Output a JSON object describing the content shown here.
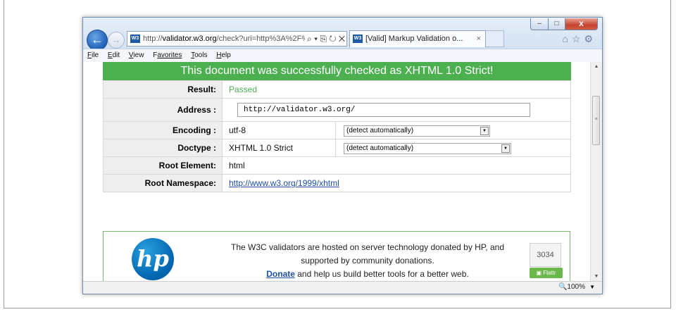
{
  "browser": {
    "address_url_prefix": "http://",
    "address_url_host": "validator.w3.org",
    "address_url_rest": "/check?uri=http%3A%2F%",
    "address_controls": "⌕ ▾ ⎘ ↻ ✕",
    "tab_title": "[Valid] Markup Validation o...",
    "tab_close": "×",
    "favicon_text": "W3",
    "back_glyph": "←",
    "forward_glyph": "→",
    "window_controls": {
      "min": "‒",
      "max": "□",
      "close": "x"
    },
    "toolbar_icons": [
      "home-icon",
      "star-icon",
      "gear-icon"
    ],
    "toolbar_glyphs": "⌂☆⚙",
    "menu": [
      {
        "underline": "F",
        "rest": "ile"
      },
      {
        "underline": "E",
        "rest": "dit"
      },
      {
        "underline": "V",
        "rest": "iew"
      },
      {
        "underline": "F",
        "rest": "avorites"
      },
      {
        "underline": "T",
        "rest": "ools"
      },
      {
        "underline": "H",
        "rest": "elp"
      }
    ],
    "zoom": "100%",
    "zoom_icon": "🔍",
    "zoom_dropdown": "▼"
  },
  "validation": {
    "banner": "This document was successfully checked as XHTML 1.0 Strict!",
    "rows": {
      "result_label": "Result:",
      "result_value": "Passed",
      "address_label": "Address :",
      "address_value": "http://validator.w3.org/",
      "encoding_label": "Encoding :",
      "encoding_value": "utf-8",
      "encoding_select": "(detect automatically)",
      "doctype_label": "Doctype :",
      "doctype_value": "XHTML 1.0 Strict",
      "doctype_select": "(detect automatically)",
      "root_element_label": "Root Element:",
      "root_element_value": "html",
      "root_ns_label": "Root Namespace:",
      "root_ns_value": "http://www.w3.org/1999/xhtml"
    },
    "colors": {
      "banner_bg": "#4caf50",
      "passed_text": "#4caf50",
      "link": "#1f4fa0"
    }
  },
  "sponsor": {
    "logo_text": "hp",
    "line1": "The W3C validators are hosted on server technology donated by HP, and",
    "line2": "supported by community donations.",
    "donate_link": "Donate",
    "line3_rest": " and help us build better tools for a better web.",
    "flattr_count": "3034",
    "flattr_label": "Flattr"
  }
}
